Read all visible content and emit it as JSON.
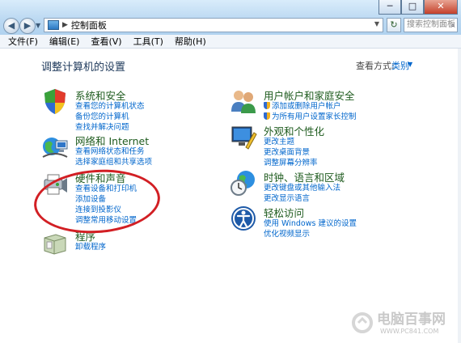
{
  "window": {
    "controls": {
      "minimize": "─",
      "maximize": "□",
      "close": "✕"
    }
  },
  "address": {
    "path": "控制面板",
    "search_placeholder": "搜索控制面板"
  },
  "menu": [
    "文件(F)",
    "编辑(E)",
    "查看(V)",
    "工具(T)",
    "帮助(H)"
  ],
  "main": {
    "title": "调整计算机的设置",
    "view_by_label": "查看方式:",
    "view_by_value": "类别"
  },
  "categories": [
    {
      "title": "系统和安全",
      "icon": "shield-security-icon",
      "links": [
        "查看您的计算机状态",
        "备份您的计算机",
        "查找并解决问题"
      ]
    },
    {
      "title": "网络和 Internet",
      "icon": "network-globe-icon",
      "links": [
        "查看网络状态和任务",
        "选择家庭组和共享选项"
      ]
    },
    {
      "title": "硬件和声音",
      "icon": "printer-speaker-icon",
      "links": [
        "查看设备和打印机",
        "添加设备",
        "连接到投影仪",
        "调整常用移动设置"
      ]
    },
    {
      "title": "程序",
      "icon": "programs-box-icon",
      "links": [
        "卸载程序"
      ]
    },
    {
      "title": "用户帐户和家庭安全",
      "icon": "users-icon",
      "links": [
        "添加或删除用户帐户",
        "为所有用户设置家长控制"
      ]
    },
    {
      "title": "外观和个性化",
      "icon": "monitor-paint-icon",
      "links": [
        "更改主题",
        "更改桌面背景",
        "调整屏幕分辨率"
      ]
    },
    {
      "title": "时钟、语言和区域",
      "icon": "clock-globe-icon",
      "links": [
        "更改键盘或其他输入法",
        "更改显示语言"
      ]
    },
    {
      "title": "轻松访问",
      "icon": "ease-of-access-icon",
      "links": [
        "使用 Windows 建议的设置",
        "优化视频显示"
      ]
    }
  ],
  "watermark": {
    "text": "电脑百事网",
    "url": "WWW.PC841.COM"
  },
  "colors": {
    "link": "#0066cc",
    "category_title": "#1e5b1e",
    "highlight_ellipse": "#d21f24"
  }
}
